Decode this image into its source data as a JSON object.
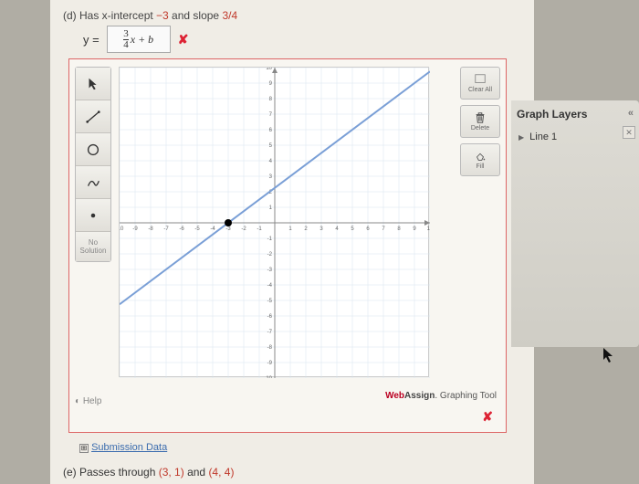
{
  "problem_d": {
    "label_prefix": "(d) Has x-intercept ",
    "xintercept": "−3",
    "label_mid": " and slope ",
    "slope": "3/4",
    "eq_lhs": "y =",
    "eq_input_num": "3",
    "eq_input_den": "4",
    "eq_input_rest": "x + b",
    "mark": "✘"
  },
  "toolbar": {
    "pointer": "pointer-icon",
    "line": "line-icon",
    "circle": "circle-icon",
    "freehand": "freehand-icon",
    "point": "point-icon",
    "nosolution_line1": "No",
    "nosolution_line2": "Solution"
  },
  "help_label": "Help",
  "actions": {
    "clearall": "Clear All",
    "delete": "Delete",
    "fill": "Fill"
  },
  "watermark": {
    "wa1": "Web",
    "wa2": "Assign",
    "suffix": ". Graphing Tool"
  },
  "close_label": "✘",
  "submission": {
    "icon": "⊞",
    "label": "Submission Data"
  },
  "problem_e": {
    "label_prefix": "(e) Passes through ",
    "pt1": "(3, 1)",
    "mid": " and ",
    "pt2": "(4, 4)"
  },
  "side": {
    "title": "Graph Layers",
    "collapse": "«",
    "layer1": "Line 1",
    "layer_close": "✕"
  },
  "chart_data": {
    "type": "line",
    "title": "",
    "xlabel": "",
    "ylabel": "",
    "xlim": [
      -10,
      10
    ],
    "ylim": [
      -10,
      10
    ],
    "grid": true,
    "series": [
      {
        "name": "Line 1",
        "x": [
          -10,
          10
        ],
        "y": [
          -5.25,
          9.75
        ]
      }
    ],
    "points": [
      {
        "x": -3,
        "y": 0
      }
    ]
  }
}
